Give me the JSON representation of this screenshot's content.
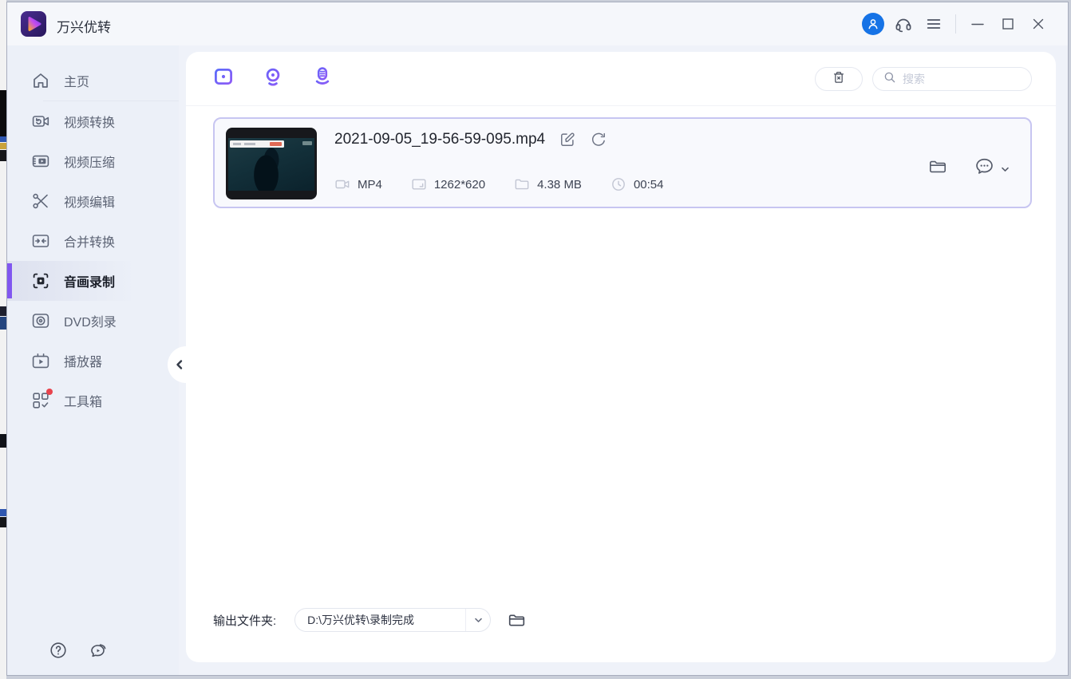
{
  "app": {
    "title": "万兴优转"
  },
  "titlebar": {
    "icons": {
      "avatar": "user-avatar",
      "headset": "support-headset",
      "menu": "hamburger-menu"
    },
    "controls": {
      "minimize": "minimize",
      "maximize": "maximize",
      "close": "close"
    }
  },
  "sidebar": {
    "items": [
      {
        "label": "主页",
        "icon": "home-icon",
        "selected": false
      },
      {
        "label": "视频转换",
        "icon": "video-convert-icon",
        "selected": false
      },
      {
        "label": "视频压缩",
        "icon": "video-compress-icon",
        "selected": false
      },
      {
        "label": "视频编辑",
        "icon": "scissors-icon",
        "selected": false
      },
      {
        "label": "合并转换",
        "icon": "merge-icon",
        "selected": false
      },
      {
        "label": "音画录制",
        "icon": "screen-record-icon",
        "selected": true
      },
      {
        "label": "DVD刻录",
        "icon": "dvd-icon",
        "selected": false
      },
      {
        "label": "播放器",
        "icon": "player-icon",
        "selected": false
      },
      {
        "label": "工具箱",
        "icon": "toolbox-icon",
        "selected": false,
        "badge": true
      }
    ]
  },
  "toolbar": {
    "record_modes": [
      "screen-recorder",
      "webcam-recorder",
      "audio-recorder"
    ],
    "search_placeholder": "搜索"
  },
  "file": {
    "name": "2021-09-05_19-56-59-095.mp4",
    "format": "MP4",
    "resolution": "1262*620",
    "size": "4.38 MB",
    "duration": "00:54"
  },
  "output": {
    "label": "输出文件夹:",
    "path": "D:\\万兴优转\\录制完成"
  },
  "colors": {
    "accent_purple": "#7a5ef7",
    "selected_bar": "#8157f0",
    "avatar_blue": "#1673e6",
    "card_border": "#c7c5f1",
    "badge_red": "#e8434d"
  }
}
